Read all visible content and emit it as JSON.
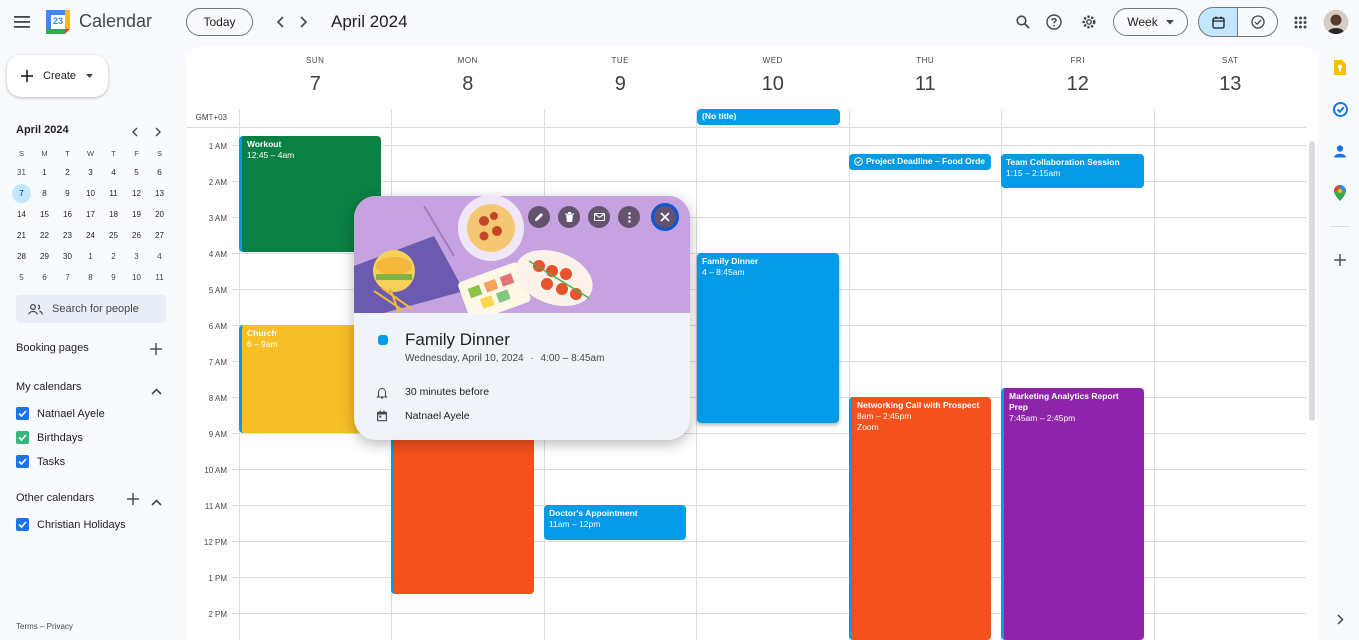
{
  "header": {
    "app_title": "Calendar",
    "logo_day": "23",
    "today_label": "Today",
    "month_title": "April 2024",
    "view_label": "Week"
  },
  "sidebar": {
    "create_label": "Create",
    "mini_month": "April 2024",
    "mini_dow": [
      "S",
      "M",
      "T",
      "W",
      "T",
      "F",
      "S"
    ],
    "mini_weeks": [
      [
        "31",
        "1",
        "2",
        "3",
        "4",
        "5",
        "6"
      ],
      [
        "7",
        "8",
        "9",
        "10",
        "11",
        "12",
        "13"
      ],
      [
        "14",
        "15",
        "16",
        "17",
        "18",
        "19",
        "20"
      ],
      [
        "21",
        "22",
        "23",
        "24",
        "25",
        "26",
        "27"
      ],
      [
        "28",
        "29",
        "30",
        "1",
        "2",
        "3",
        "4"
      ],
      [
        "5",
        "6",
        "7",
        "8",
        "9",
        "10",
        "11"
      ]
    ],
    "search_placeholder": "Search for people",
    "booking_pages": "Booking pages",
    "my_calendars": "My calendars",
    "my_calendar_items": [
      {
        "label": "Natnael Ayele",
        "color": "#1a73e8"
      },
      {
        "label": "Birthdays",
        "color": "#33b679"
      },
      {
        "label": "Tasks",
        "color": "#1a73e8"
      }
    ],
    "other_calendars": "Other calendars",
    "other_calendar_items": [
      {
        "label": "Christian Holidays",
        "color": "#1a73e8"
      }
    ],
    "footer": "Terms – Privacy"
  },
  "grid": {
    "timezone": "GMT+03",
    "days": [
      {
        "dow": "SUN",
        "num": "7"
      },
      {
        "dow": "MON",
        "num": "8"
      },
      {
        "dow": "TUE",
        "num": "9"
      },
      {
        "dow": "WED",
        "num": "10"
      },
      {
        "dow": "THU",
        "num": "11"
      },
      {
        "dow": "FRI",
        "num": "12"
      },
      {
        "dow": "SAT",
        "num": "13"
      }
    ],
    "hours": [
      "1 AM",
      "2 AM",
      "3 AM",
      "4 AM",
      "5 AM",
      "6 AM",
      "7 AM",
      "8 AM",
      "9 AM",
      "10 AM",
      "11 AM",
      "12 PM",
      "1 PM",
      "2 PM"
    ]
  },
  "events": {
    "no_title": "(No title)",
    "workout": {
      "title": "Workout",
      "time": "12:45 – 4am"
    },
    "church": {
      "title": "Church",
      "time": "6 – 9am"
    },
    "family_dinner": {
      "title": "Family Dinner",
      "time": "4 – 8:45am"
    },
    "project_deadline": {
      "title": "Project Deadline – Food Orde"
    },
    "team_collab": {
      "title": "Team Collaboration Session",
      "time": "1:15 – 2:15am"
    },
    "networking": {
      "title": "Networking Call with Prospect",
      "time": "8am – 2:45pm",
      "location": "Zoom"
    },
    "marketing": {
      "title": "Marketing Analytics Report Prep",
      "time": "7:45am – 2:45pm"
    },
    "doctor": {
      "title": "Doctor's Appointment",
      "time": "11am – 12pm"
    }
  },
  "popup": {
    "title": "Family Dinner",
    "date": "Wednesday, April 10, 2024",
    "separator": "·",
    "time": "4:00 – 8:45am",
    "reminder": "30 minutes before",
    "calendar": "Natnael Ayele"
  },
  "colors": {
    "green": "#0b8043",
    "yellow": "#f6bf26",
    "blue": "#039be5",
    "orange": "#f4511e",
    "purple": "#8e24aa"
  }
}
